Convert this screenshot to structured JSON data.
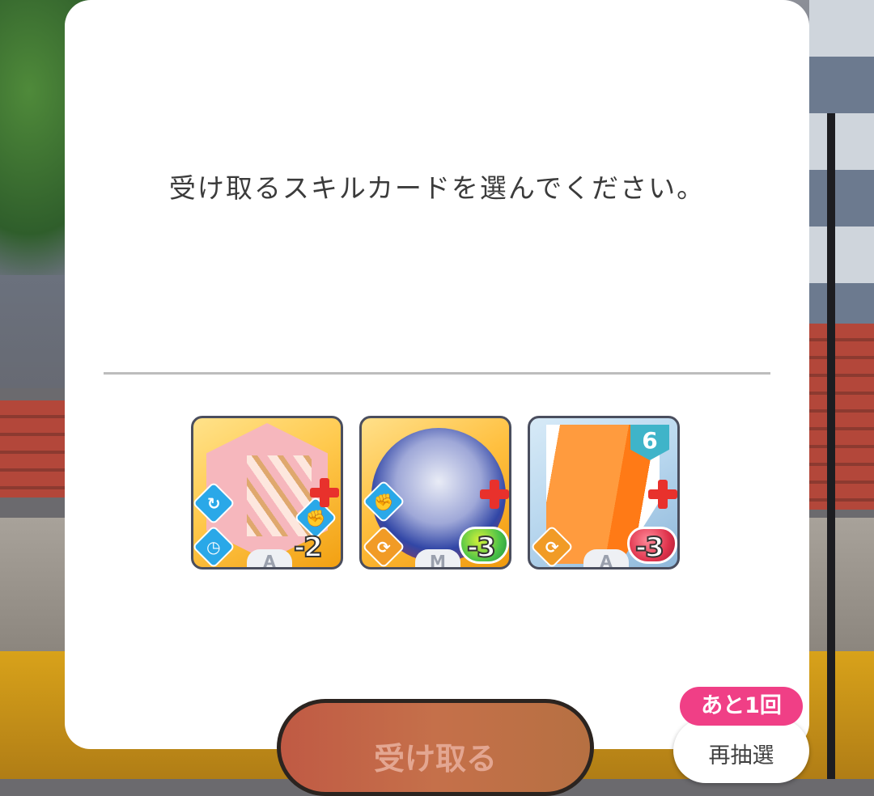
{
  "dialog": {
    "title": "受け取るスキルカードを選んでください。"
  },
  "cards": [
    {
      "plan_label": "A",
      "cost": "-2",
      "icons": [
        "retain-icon",
        "clock-icon",
        "fist-icon",
        "plus-icon"
      ]
    },
    {
      "plan_label": "M",
      "cost": "-3",
      "icons": [
        "fist-icon",
        "cycle-icon",
        "green-heart-icon",
        "plus-icon"
      ]
    },
    {
      "plan_label": "A",
      "cost": "-3",
      "level": "6",
      "icons": [
        "cycle-icon",
        "red-heart-icon",
        "plus-icon"
      ]
    }
  ],
  "buttons": {
    "receive_label": "受け取る",
    "reroll_label": "再抽選",
    "remaining_label": "あと1回"
  },
  "colors": {
    "accent_pink": "#f03f86",
    "receive_button": "#c5704a",
    "dialog_bg": "#ffffff"
  }
}
